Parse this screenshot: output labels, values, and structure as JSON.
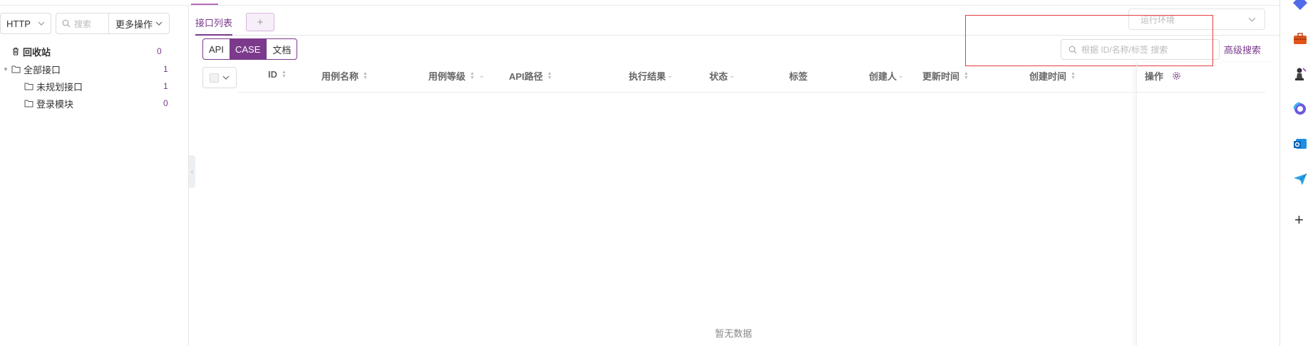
{
  "top": {
    "accent_color": "#b26bb9"
  },
  "left_panel": {
    "protocol": "HTTP",
    "search_placeholder": "搜索",
    "more_label": "更多操作",
    "recycle": {
      "label": "回收站",
      "count": "0"
    },
    "tree": [
      {
        "label": "全部接口",
        "count": "1"
      },
      {
        "label": "未规划接口",
        "count": "1"
      },
      {
        "label": "登录模块",
        "count": "0"
      }
    ]
  },
  "tabs": {
    "active": "接口列表",
    "add": "+"
  },
  "env": {
    "placeholder": "运行环境"
  },
  "segment": {
    "items": [
      "API",
      "CASE",
      "文档"
    ],
    "selected": "CASE"
  },
  "search": {
    "placeholder": "根据 ID/名称/标签 搜索",
    "advanced": "高级搜索"
  },
  "table": {
    "columns": [
      "ID",
      "用例名称",
      "用例等级",
      "API路径",
      "执行结果",
      "状态",
      "标签",
      "创建人",
      "更新时间",
      "创建时间",
      "操作"
    ],
    "empty_text": "暂无数据"
  },
  "colors": {
    "accent": "#7b3a8c",
    "highlight_box": "#e53e3e"
  },
  "rail_icons": [
    "diamond-icon",
    "toolbox-icon",
    "chess-icon",
    "copilot-icon",
    "outlook-icon",
    "send-icon",
    "plus-icon"
  ]
}
